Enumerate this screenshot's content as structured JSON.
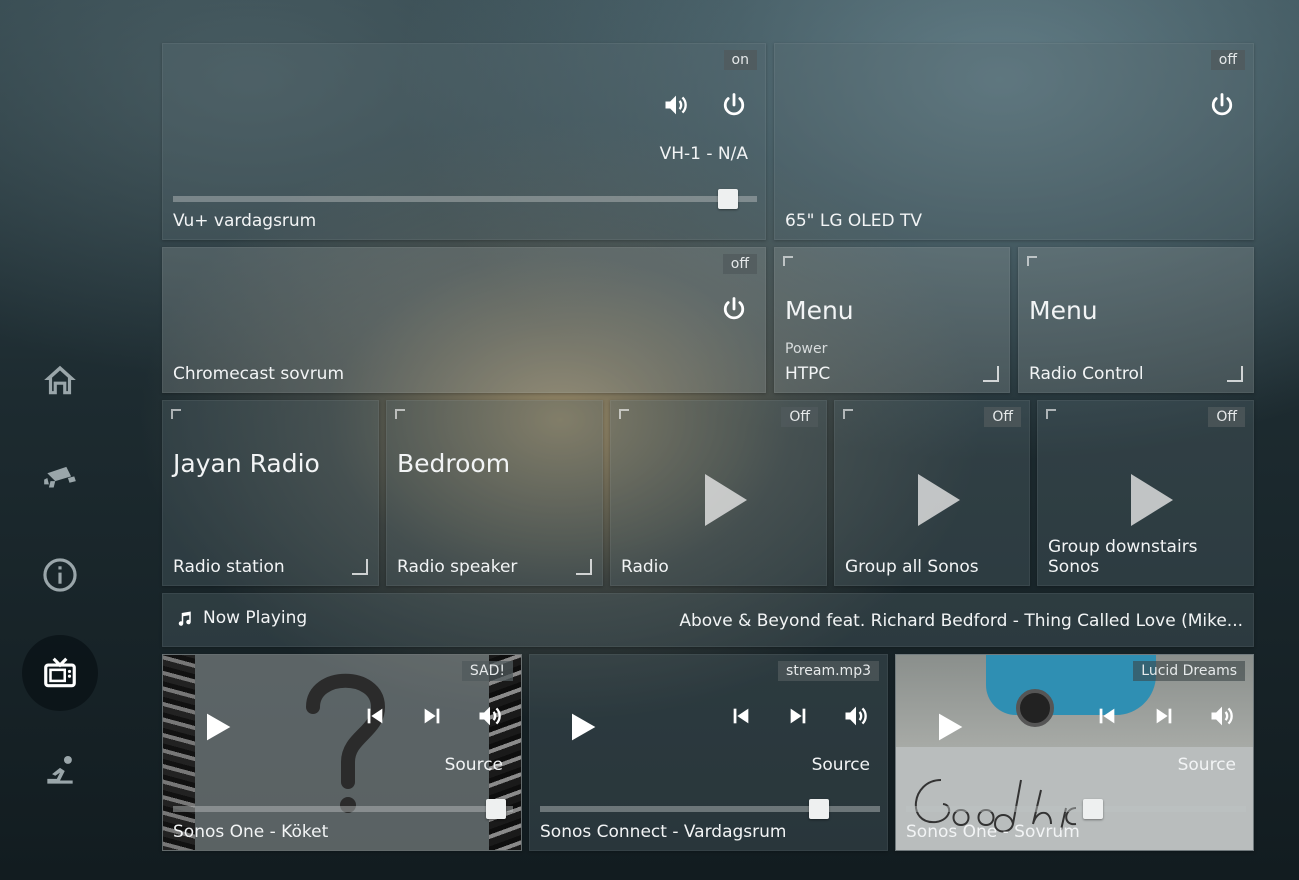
{
  "nav": [
    {
      "icon": "home-icon"
    },
    {
      "icon": "camera-icon"
    },
    {
      "icon": "info-icon"
    },
    {
      "icon": "tv-icon"
    },
    {
      "icon": "person-icon"
    }
  ],
  "vu": {
    "label": "Vu+ vardagsrum",
    "state": "on",
    "channel": "VH-1 - N/A",
    "volume": 0.95
  },
  "lg": {
    "label": "65\" LG OLED TV",
    "state": "off"
  },
  "chromecast": {
    "label": "Chromecast sovrum",
    "state": "off"
  },
  "menu_htpc": {
    "title": "Menu",
    "sub": "Power",
    "label": "HTPC"
  },
  "menu_radio": {
    "title": "Menu",
    "label": "Radio Control"
  },
  "jayan": {
    "title": "Jayan Radio",
    "label": "Radio station"
  },
  "bedroom": {
    "title": "Bedroom",
    "label": "Radio speaker"
  },
  "radio": {
    "label": "Radio",
    "state": "Off"
  },
  "group_all": {
    "label": "Group all Sonos",
    "state": "Off"
  },
  "group_down": {
    "label": "Group downstairs Sonos",
    "state": "Off"
  },
  "now_playing": {
    "label": "Now Playing",
    "track": "Above & Beyond feat. Richard Bedford - Thing Called Love (Mike..."
  },
  "players": [
    {
      "label": "Sonos One - Köket",
      "badge": "SAD!",
      "source": "Source",
      "volume": 0.95
    },
    {
      "label": "Sonos Connect - Vardagsrum",
      "badge": "stream.mp3",
      "source": "Source",
      "volume": 0.82
    },
    {
      "label": "Sonos One - Sovrum",
      "badge": "Lucid Dreams",
      "source": "Source",
      "volume": 0.55
    }
  ],
  "colors": {
    "accent": "#eef0f0",
    "tile": "#5a6e73"
  }
}
